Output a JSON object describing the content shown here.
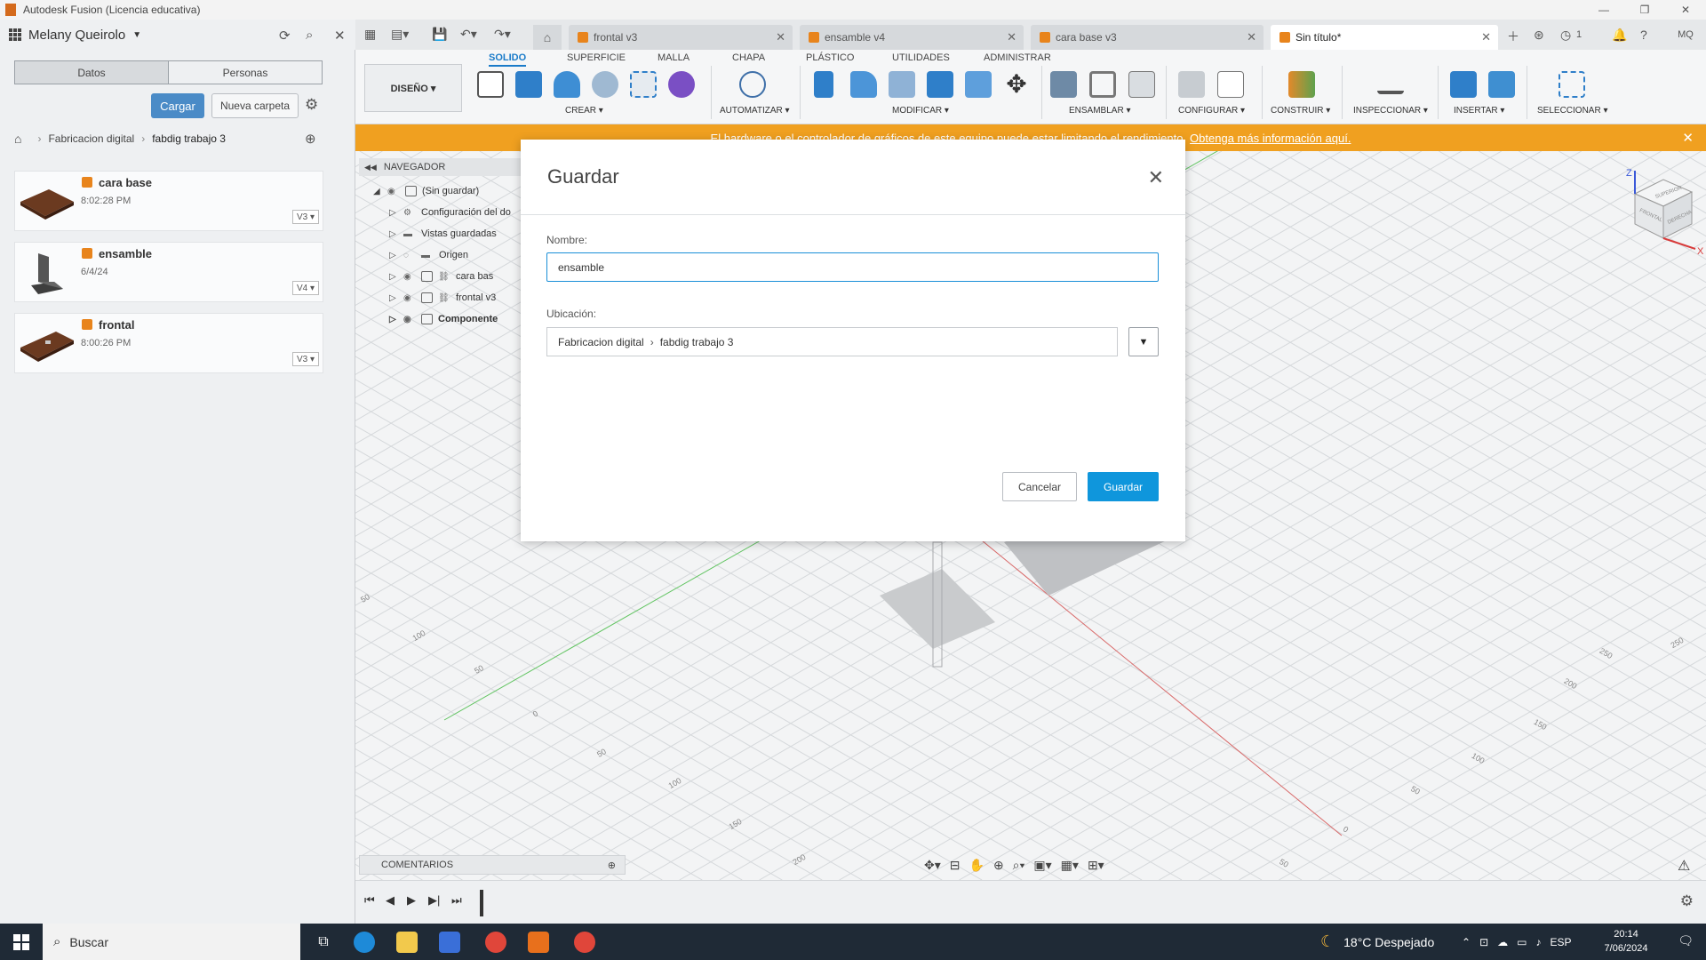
{
  "window": {
    "title": "Autodesk Fusion (Licencia educativa)",
    "controls": [
      "—",
      "❐",
      "✕"
    ]
  },
  "app": {
    "user_name": "Melany Queirolo",
    "user_initials": "MQ",
    "notifications_count": "1"
  },
  "tabs": [
    {
      "label": "frontal v3",
      "active": false
    },
    {
      "label": "ensamble v4",
      "active": false
    },
    {
      "label": "cara base v3",
      "active": false
    },
    {
      "label": "Sin título*",
      "active": true
    }
  ],
  "data_panel": {
    "tab_datos": "Datos",
    "tab_personas": "Personas",
    "upload_label": "Cargar",
    "new_folder_label": "Nueva carpeta",
    "breadcrumb": [
      "Fabricacion digital",
      "fabdig trabajo 3"
    ],
    "files": [
      {
        "name": "cara base",
        "time": "8:02:28 PM",
        "version": "V3 ▾"
      },
      {
        "name": "ensamble",
        "time": "6/4/24",
        "version": "V4 ▾"
      },
      {
        "name": "frontal",
        "time": "8:00:26 PM",
        "version": "V3 ▾"
      }
    ]
  },
  "toolbar": {
    "workspace": "DISEÑO ▾",
    "tabs": [
      "SOLIDO",
      "SUPERFICIE",
      "MALLA",
      "CHAPA",
      "PLÁSTICO",
      "UTILIDADES",
      "ADMINISTRAR"
    ],
    "groups": [
      "CREAR ▾",
      "AUTOMATIZAR ▾",
      "MODIFICAR ▾",
      "ENSAMBLAR ▾",
      "CONFIGURAR ▾",
      "CONSTRUIR ▾",
      "INSPECCIONAR ▾",
      "INSERTAR ▾",
      "SELECCIONAR ▾"
    ]
  },
  "banner": {
    "text": "El hardware o el controlador de gráficos de este equipo puede estar limitando el rendimiento.",
    "link": "Obtenga más información aquí."
  },
  "navigator": {
    "title": "NAVEGADOR",
    "rows": [
      "(Sin guardar)",
      "Configuración del do",
      "Vistas guardadas",
      "Origen",
      "cara bas",
      "frontal v3",
      "Componente"
    ]
  },
  "comments": {
    "label": "COMENTARIOS"
  },
  "viewcube": {
    "top": "SUPERIOR",
    "front": "FRONTAL",
    "right": "DERECHA",
    "z": "Z",
    "x": "X"
  },
  "dialog": {
    "title": "Guardar",
    "name_label": "Nombre:",
    "name_value": "ensamble",
    "location_label": "Ubicación:",
    "location_path": [
      "Fabricacion digital",
      "fabdig trabajo 3"
    ],
    "cancel_label": "Cancelar",
    "save_label": "Guardar"
  },
  "axis_labels": [
    "50",
    "100",
    "50",
    "0",
    "50",
    "100",
    "150",
    "200",
    "250",
    "200",
    "150",
    "100",
    "50",
    "0",
    "50",
    "250"
  ],
  "taskbar": {
    "search_placeholder": "Buscar",
    "weather": "18°C  Despejado",
    "language": "ESP",
    "time": "20:14",
    "date": "7/06/2024"
  }
}
